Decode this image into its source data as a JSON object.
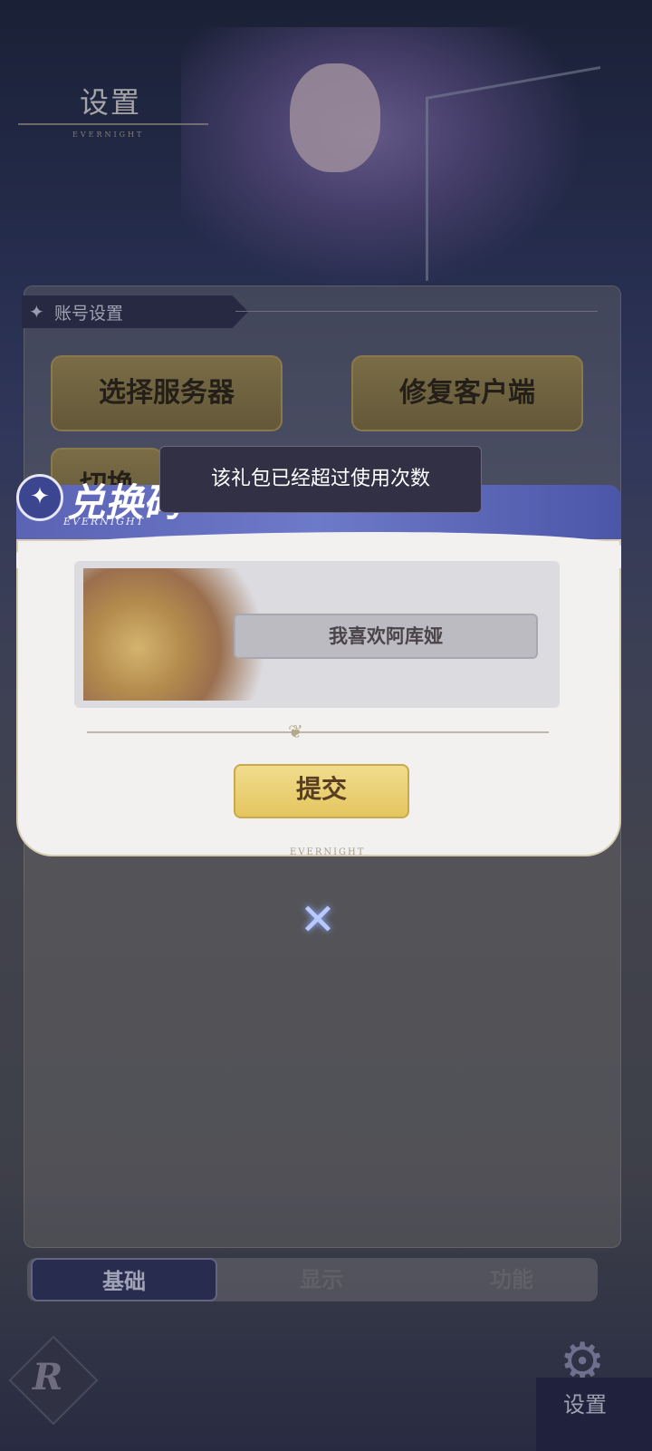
{
  "page": {
    "title": "设置",
    "title_sub": "EVERNIGHT"
  },
  "account_section": {
    "label": "账号设置"
  },
  "buttons": {
    "select_server": "选择服务器",
    "repair_client": "修复客户端",
    "partial": "切换"
  },
  "tabs": [
    {
      "label": "基础",
      "active": true
    },
    {
      "label": "显示",
      "active": false
    },
    {
      "label": "功能",
      "active": false
    }
  ],
  "corner": {
    "settings_label": "设置",
    "logo_letter": "R"
  },
  "dialog": {
    "title": "兑换码",
    "title_sub": "EVERNIGHT",
    "code_value": "我喜欢阿库娅",
    "submit_label": "提交",
    "footer_brand": "EVERNIGHT"
  },
  "toast": {
    "message": "该礼包已经超过使用次数"
  },
  "icons": {
    "close": "close-x-icon",
    "gear": "gear-icon",
    "star": "star-icon"
  }
}
